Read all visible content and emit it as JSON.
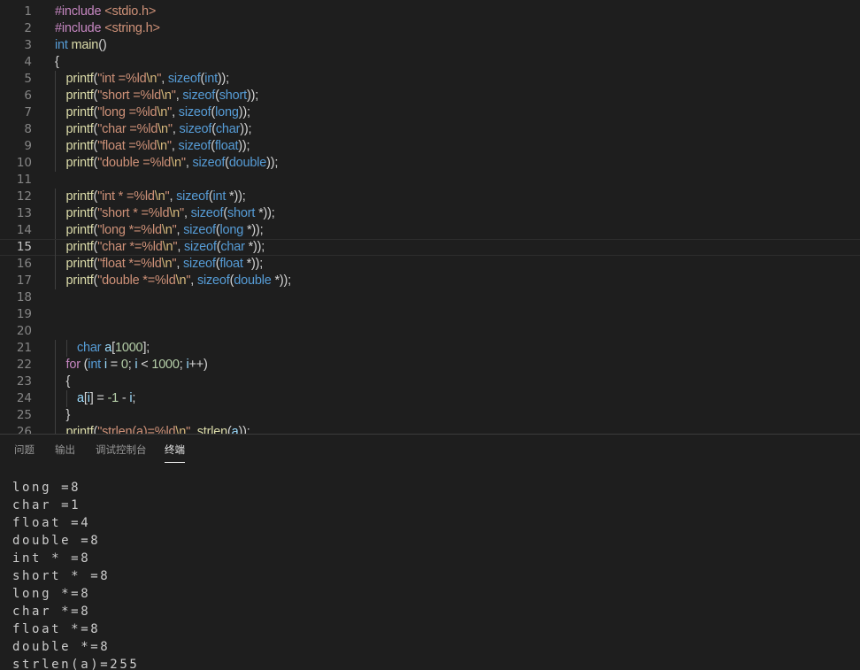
{
  "editor": {
    "current_line": 15,
    "lines": [
      {
        "n": 1,
        "indent": 0,
        "tokens": [
          [
            "pre",
            "#include "
          ],
          [
            "str",
            "<stdio.h>"
          ]
        ]
      },
      {
        "n": 2,
        "indent": 0,
        "tokens": [
          [
            "pre",
            "#include "
          ],
          [
            "str",
            "<string.h>"
          ]
        ]
      },
      {
        "n": 3,
        "indent": 0,
        "tokens": [
          [
            "kw",
            "int "
          ],
          [
            "fn",
            "main"
          ],
          [
            "def",
            "()"
          ]
        ]
      },
      {
        "n": 4,
        "indent": 0,
        "tokens": [
          [
            "def",
            "{"
          ]
        ]
      },
      {
        "n": 5,
        "indent": 1,
        "tokens": [
          [
            "fn",
            "printf"
          ],
          [
            "def",
            "("
          ],
          [
            "str",
            "\"int =%ld"
          ],
          [
            "esc",
            "\\n"
          ],
          [
            "str",
            "\""
          ],
          [
            "def",
            ", "
          ],
          [
            "kw",
            "sizeof"
          ],
          [
            "def",
            "("
          ],
          [
            "kw",
            "int"
          ],
          [
            "def",
            "));"
          ]
        ]
      },
      {
        "n": 6,
        "indent": 1,
        "tokens": [
          [
            "fn",
            "printf"
          ],
          [
            "def",
            "("
          ],
          [
            "str",
            "\"short =%ld"
          ],
          [
            "esc",
            "\\n"
          ],
          [
            "str",
            "\""
          ],
          [
            "def",
            ", "
          ],
          [
            "kw",
            "sizeof"
          ],
          [
            "def",
            "("
          ],
          [
            "kw",
            "short"
          ],
          [
            "def",
            "));"
          ]
        ]
      },
      {
        "n": 7,
        "indent": 1,
        "tokens": [
          [
            "fn",
            "printf"
          ],
          [
            "def",
            "("
          ],
          [
            "str",
            "\"long =%ld"
          ],
          [
            "esc",
            "\\n"
          ],
          [
            "str",
            "\""
          ],
          [
            "def",
            ", "
          ],
          [
            "kw",
            "sizeof"
          ],
          [
            "def",
            "("
          ],
          [
            "kw",
            "long"
          ],
          [
            "def",
            "));"
          ]
        ]
      },
      {
        "n": 8,
        "indent": 1,
        "tokens": [
          [
            "fn",
            "printf"
          ],
          [
            "def",
            "("
          ],
          [
            "str",
            "\"char =%ld"
          ],
          [
            "esc",
            "\\n"
          ],
          [
            "str",
            "\""
          ],
          [
            "def",
            ", "
          ],
          [
            "kw",
            "sizeof"
          ],
          [
            "def",
            "("
          ],
          [
            "kw",
            "char"
          ],
          [
            "def",
            "));"
          ]
        ]
      },
      {
        "n": 9,
        "indent": 1,
        "tokens": [
          [
            "fn",
            "printf"
          ],
          [
            "def",
            "("
          ],
          [
            "str",
            "\"float =%ld"
          ],
          [
            "esc",
            "\\n"
          ],
          [
            "str",
            "\""
          ],
          [
            "def",
            ", "
          ],
          [
            "kw",
            "sizeof"
          ],
          [
            "def",
            "("
          ],
          [
            "kw",
            "float"
          ],
          [
            "def",
            "));"
          ]
        ]
      },
      {
        "n": 10,
        "indent": 1,
        "tokens": [
          [
            "fn",
            "printf"
          ],
          [
            "def",
            "("
          ],
          [
            "str",
            "\"double =%ld"
          ],
          [
            "esc",
            "\\n"
          ],
          [
            "str",
            "\""
          ],
          [
            "def",
            ", "
          ],
          [
            "kw",
            "sizeof"
          ],
          [
            "def",
            "("
          ],
          [
            "kw",
            "double"
          ],
          [
            "def",
            "));"
          ]
        ]
      },
      {
        "n": 11,
        "indent": 0,
        "tokens": []
      },
      {
        "n": 12,
        "indent": 1,
        "tokens": [
          [
            "fn",
            "printf"
          ],
          [
            "def",
            "("
          ],
          [
            "str",
            "\"int * =%ld"
          ],
          [
            "esc",
            "\\n"
          ],
          [
            "str",
            "\""
          ],
          [
            "def",
            ", "
          ],
          [
            "kw",
            "sizeof"
          ],
          [
            "def",
            "("
          ],
          [
            "kw",
            "int "
          ],
          [
            "def",
            "*));"
          ]
        ]
      },
      {
        "n": 13,
        "indent": 1,
        "tokens": [
          [
            "fn",
            "printf"
          ],
          [
            "def",
            "("
          ],
          [
            "str",
            "\"short * =%ld"
          ],
          [
            "esc",
            "\\n"
          ],
          [
            "str",
            "\""
          ],
          [
            "def",
            ", "
          ],
          [
            "kw",
            "sizeof"
          ],
          [
            "def",
            "("
          ],
          [
            "kw",
            "short "
          ],
          [
            "def",
            "*));"
          ]
        ]
      },
      {
        "n": 14,
        "indent": 1,
        "tokens": [
          [
            "fn",
            "printf"
          ],
          [
            "def",
            "("
          ],
          [
            "str",
            "\"long *=%ld"
          ],
          [
            "esc",
            "\\n"
          ],
          [
            "str",
            "\""
          ],
          [
            "def",
            ", "
          ],
          [
            "kw",
            "sizeof"
          ],
          [
            "def",
            "("
          ],
          [
            "kw",
            "long "
          ],
          [
            "def",
            "*));"
          ]
        ]
      },
      {
        "n": 15,
        "indent": 1,
        "tokens": [
          [
            "fn",
            "printf"
          ],
          [
            "def",
            "("
          ],
          [
            "str",
            "\"char *=%ld"
          ],
          [
            "esc",
            "\\n"
          ],
          [
            "str",
            "\""
          ],
          [
            "def",
            ", "
          ],
          [
            "kw",
            "sizeof"
          ],
          [
            "def",
            "("
          ],
          [
            "kw",
            "char "
          ],
          [
            "def",
            "*));"
          ]
        ]
      },
      {
        "n": 16,
        "indent": 1,
        "tokens": [
          [
            "fn",
            "printf"
          ],
          [
            "def",
            "("
          ],
          [
            "str",
            "\"float *=%ld"
          ],
          [
            "esc",
            "\\n"
          ],
          [
            "str",
            "\""
          ],
          [
            "def",
            ", "
          ],
          [
            "kw",
            "sizeof"
          ],
          [
            "def",
            "("
          ],
          [
            "kw",
            "float "
          ],
          [
            "def",
            "*));"
          ]
        ]
      },
      {
        "n": 17,
        "indent": 1,
        "tokens": [
          [
            "fn",
            "printf"
          ],
          [
            "def",
            "("
          ],
          [
            "str",
            "\"double *=%ld"
          ],
          [
            "esc",
            "\\n"
          ],
          [
            "str",
            "\""
          ],
          [
            "def",
            ", "
          ],
          [
            "kw",
            "sizeof"
          ],
          [
            "def",
            "("
          ],
          [
            "kw",
            "double "
          ],
          [
            "def",
            "*));"
          ]
        ]
      },
      {
        "n": 18,
        "indent": 0,
        "tokens": []
      },
      {
        "n": 19,
        "indent": 0,
        "tokens": []
      },
      {
        "n": 20,
        "indent": 0,
        "tokens": []
      },
      {
        "n": 21,
        "indent": 2,
        "tokens": [
          [
            "kw",
            "char "
          ],
          [
            "var",
            "a"
          ],
          [
            "def",
            "["
          ],
          [
            "num",
            "1000"
          ],
          [
            "def",
            "];"
          ]
        ]
      },
      {
        "n": 22,
        "indent": 1,
        "tokens": [
          [
            "ctl",
            "for "
          ],
          [
            "def",
            "("
          ],
          [
            "kw",
            "int "
          ],
          [
            "var",
            "i"
          ],
          [
            "def",
            " = "
          ],
          [
            "num",
            "0"
          ],
          [
            "def",
            "; "
          ],
          [
            "var",
            "i"
          ],
          [
            "def",
            " < "
          ],
          [
            "num",
            "1000"
          ],
          [
            "def",
            "; "
          ],
          [
            "var",
            "i"
          ],
          [
            "def",
            "++)"
          ]
        ]
      },
      {
        "n": 23,
        "indent": 1,
        "tokens": [
          [
            "def",
            "{"
          ]
        ]
      },
      {
        "n": 24,
        "indent": 2,
        "tokens": [
          [
            "var",
            "a"
          ],
          [
            "def",
            "["
          ],
          [
            "var",
            "i"
          ],
          [
            "def",
            "] = "
          ],
          [
            "num",
            "-1"
          ],
          [
            "def",
            " - "
          ],
          [
            "var",
            "i"
          ],
          [
            "def",
            ";"
          ]
        ]
      },
      {
        "n": 25,
        "indent": 1,
        "tokens": [
          [
            "def",
            "}"
          ]
        ]
      },
      {
        "n": 26,
        "indent": 1,
        "tokens": [
          [
            "fn",
            "printf"
          ],
          [
            "def",
            "("
          ],
          [
            "str",
            "\"strlen(a)=%ld"
          ],
          [
            "esc",
            "\\n"
          ],
          [
            "str",
            "\""
          ],
          [
            "def",
            ", "
          ],
          [
            "fn",
            "strlen"
          ],
          [
            "def",
            "("
          ],
          [
            "var",
            "a"
          ],
          [
            "def",
            "));"
          ]
        ]
      }
    ]
  },
  "panel": {
    "tabs": [
      {
        "label": "问题",
        "active": false
      },
      {
        "label": "输出",
        "active": false
      },
      {
        "label": "调试控制台",
        "active": false
      },
      {
        "label": "终端",
        "active": true
      }
    ],
    "terminal_lines": [
      "long =8",
      "char =1",
      "float =4",
      "double =8",
      "int * =8",
      "short * =8",
      "long *=8",
      "char *=8",
      "float *=8",
      "double *=8",
      "strlen(a)=255"
    ]
  }
}
